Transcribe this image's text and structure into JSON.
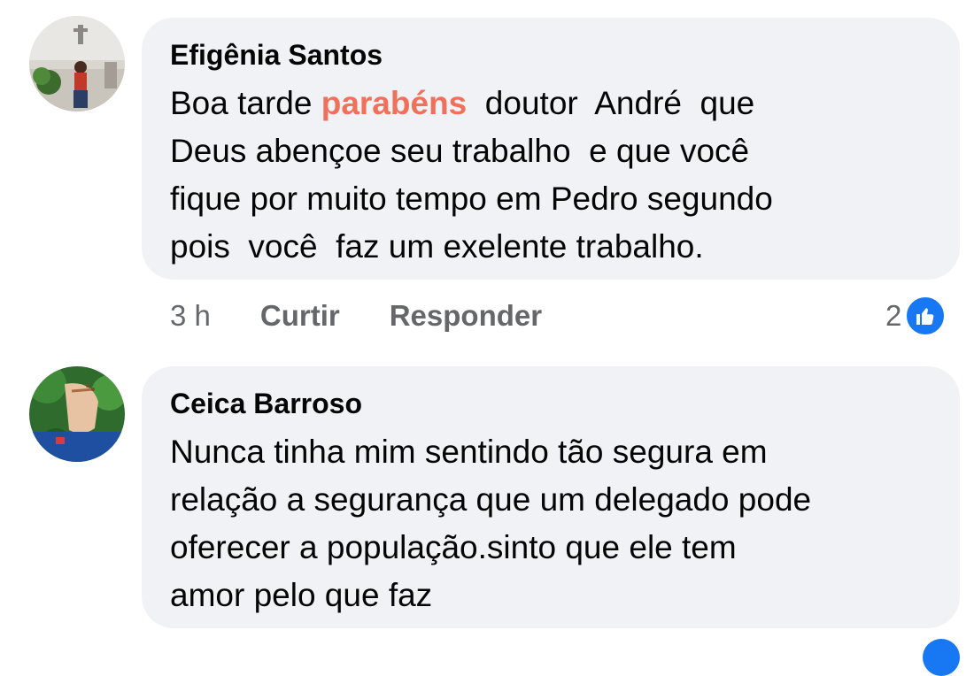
{
  "comments": [
    {
      "author": "Efigênia Santos",
      "text_before": "Boa tarde ",
      "text_highlight": "parabéns",
      "text_after": "  doutor  André  que\nDeus abençoe seu trabalho  e que você\nfique por muito tempo em Pedro segundo\npois  você  faz um exelente trabalho.",
      "time": "3 h",
      "like_label": "Curtir",
      "reply_label": "Responder",
      "reaction_count": "2",
      "reaction_icon": "thumbs-up-icon",
      "avatar_icon": "profile-photo"
    },
    {
      "author": "Ceica Barroso",
      "text": "Nunca tinha mim sentindo tão segura em\nrelação a segurança que um delegado pode\noferecer a população.sinto que ele tem\namor pelo que faz",
      "avatar_icon": "profile-photo"
    }
  ],
  "colors": {
    "highlight": "#f0715a",
    "like_blue": "#1877f2",
    "bubble_bg": "#f0f2f5",
    "meta_gray": "#65676b"
  }
}
